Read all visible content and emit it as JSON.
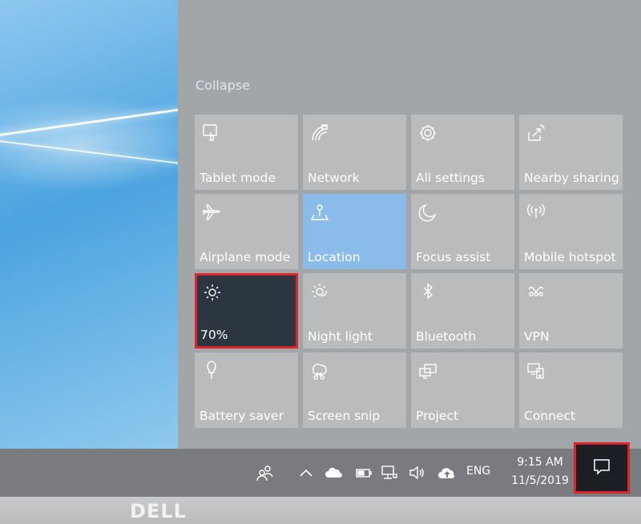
{
  "action_center": {
    "collapse_label": "Collapse",
    "tiles": [
      {
        "label": "Tablet mode",
        "icon": "tablet-mode-icon"
      },
      {
        "label": "Network",
        "icon": "network-icon"
      },
      {
        "label": "All settings",
        "icon": "gear-icon"
      },
      {
        "label": "Nearby sharing",
        "icon": "nearby-sharing-icon"
      },
      {
        "label": "Airplane mode",
        "icon": "airplane-icon"
      },
      {
        "label": "Location",
        "icon": "location-icon"
      },
      {
        "label": "Focus assist",
        "icon": "moon-icon"
      },
      {
        "label": "Mobile hotspot",
        "icon": "hotspot-icon"
      },
      {
        "label": "70%",
        "icon": "brightness-icon"
      },
      {
        "label": "Night light",
        "icon": "night-light-icon"
      },
      {
        "label": "Bluetooth",
        "icon": "bluetooth-icon"
      },
      {
        "label": "VPN",
        "icon": "vpn-icon"
      },
      {
        "label": "Battery saver",
        "icon": "battery-saver-icon"
      },
      {
        "label": "Screen snip",
        "icon": "screen-snip-icon"
      },
      {
        "label": "Project",
        "icon": "project-icon"
      },
      {
        "label": "Connect",
        "icon": "connect-icon"
      }
    ],
    "active_tile": "Location",
    "highlighted_tile": "70%"
  },
  "taskbar": {
    "language": "ENG",
    "time": "9:15 AM",
    "date": "11/5/2019",
    "tray_icons": [
      "people-icon",
      "chevron-up-icon",
      "onedrive-icon",
      "battery-icon",
      "network-wired-icon",
      "volume-icon",
      "upload-icon"
    ]
  },
  "bezel": {
    "brand_logo": "DELL"
  },
  "colors": {
    "accent": "#8bbbe8",
    "highlight": "#d9252b",
    "tile": "#b9bbbd",
    "panel": "#a3a6a9",
    "taskbar": "#797b7e"
  }
}
